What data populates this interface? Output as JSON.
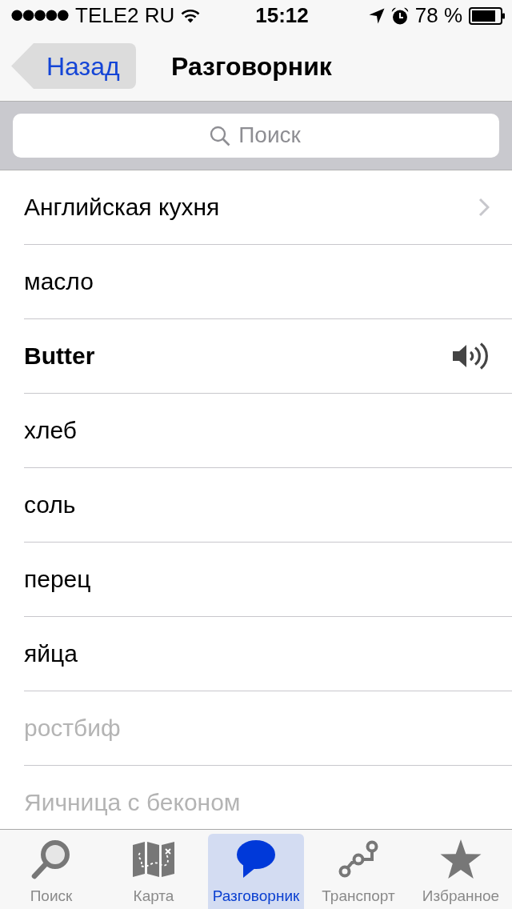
{
  "status_bar": {
    "carrier": "TELE2 RU",
    "time": "15:12",
    "battery": "78 %"
  },
  "nav_bar": {
    "back": "Назад",
    "title": "Разговорник"
  },
  "search": {
    "placeholder": "Поиск"
  },
  "rows": [
    {
      "kind": "category",
      "text": "Английская кухня",
      "disabled": false
    },
    {
      "kind": "word",
      "text": "масло",
      "disabled": false
    },
    {
      "kind": "translation",
      "text": "Butter",
      "disabled": false
    },
    {
      "kind": "word",
      "text": "хлеб",
      "disabled": false
    },
    {
      "kind": "word",
      "text": "соль",
      "disabled": false
    },
    {
      "kind": "word",
      "text": "перец",
      "disabled": false
    },
    {
      "kind": "word",
      "text": "яйца",
      "disabled": false
    },
    {
      "kind": "word",
      "text": "ростбиф",
      "disabled": true
    },
    {
      "kind": "word",
      "text": "Яичница с беконом",
      "disabled": true
    }
  ],
  "tab_bar": [
    {
      "label": "Поиск",
      "selected": false
    },
    {
      "label": "Карта",
      "selected": false
    },
    {
      "label": "Разговорник",
      "selected": true
    },
    {
      "label": "Транспорт",
      "selected": false
    },
    {
      "label": "Избранное",
      "selected": false
    }
  ]
}
